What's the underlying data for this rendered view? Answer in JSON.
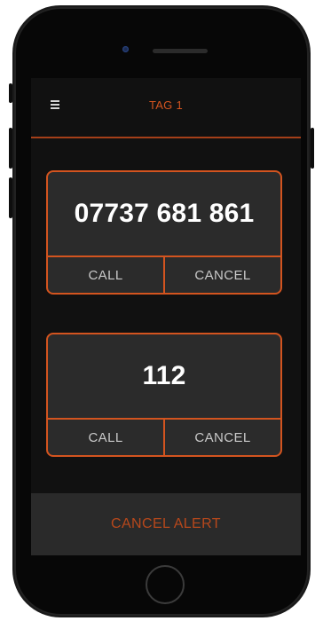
{
  "header": {
    "title": "TAG 1",
    "menu_icon": "hamburger-menu-icon"
  },
  "contacts": [
    {
      "number": "07737 681 861",
      "call_label": "CALL",
      "cancel_label": "CANCEL"
    },
    {
      "number": "112",
      "call_label": "CALL",
      "cancel_label": "CANCEL"
    }
  ],
  "footer": {
    "cancel_alert_label": "CANCEL ALERT"
  },
  "colors": {
    "accent": "#d3541f",
    "screen_bg": "#111111",
    "card_bg": "#2b2b2b"
  }
}
